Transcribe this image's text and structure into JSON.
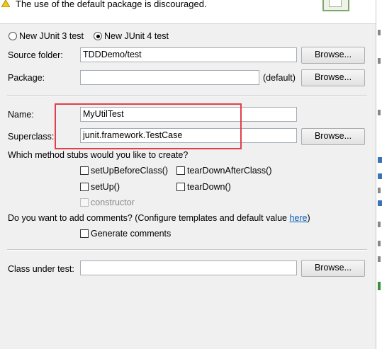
{
  "banner": {
    "message": "The use of the default package is discouraged.",
    "warning_icon": "warning-icon",
    "logo_icon": "junit-wizard-icon"
  },
  "junit_version": {
    "option3_label": "New JUnit 3 test",
    "option4_label": "New JUnit 4 test",
    "selected": "New JUnit 4 test"
  },
  "source_folder": {
    "label": "Source folder:",
    "value": "TDDDemo/test",
    "browse_label": "Browse..."
  },
  "package": {
    "label": "Package:",
    "value": "",
    "default_hint": "(default)",
    "browse_label": "Browse..."
  },
  "name": {
    "label": "Name:",
    "value": "MyUtilTest"
  },
  "superclass": {
    "label": "Superclass:",
    "value": "junit.framework.TestCase",
    "browse_label": "Browse..."
  },
  "method_stubs": {
    "question": "Which method stubs would you like to create?",
    "setUpBeforeClass": "setUpBeforeClass()",
    "tearDownAfterClass": "tearDownAfterClass()",
    "setUp": "setUp()",
    "tearDown": "tearDown()",
    "constructor": "constructor"
  },
  "comments": {
    "question_prefix": "Do you want to add comments? (Configure templates and default value ",
    "link": "here",
    "question_suffix": ")",
    "generate_label": "Generate comments"
  },
  "class_under_test": {
    "label": "Class under test:",
    "value": "",
    "browse_label": "Browse..."
  },
  "colors": {
    "highlight": "#e0404a",
    "link": "#0b5fb5"
  }
}
